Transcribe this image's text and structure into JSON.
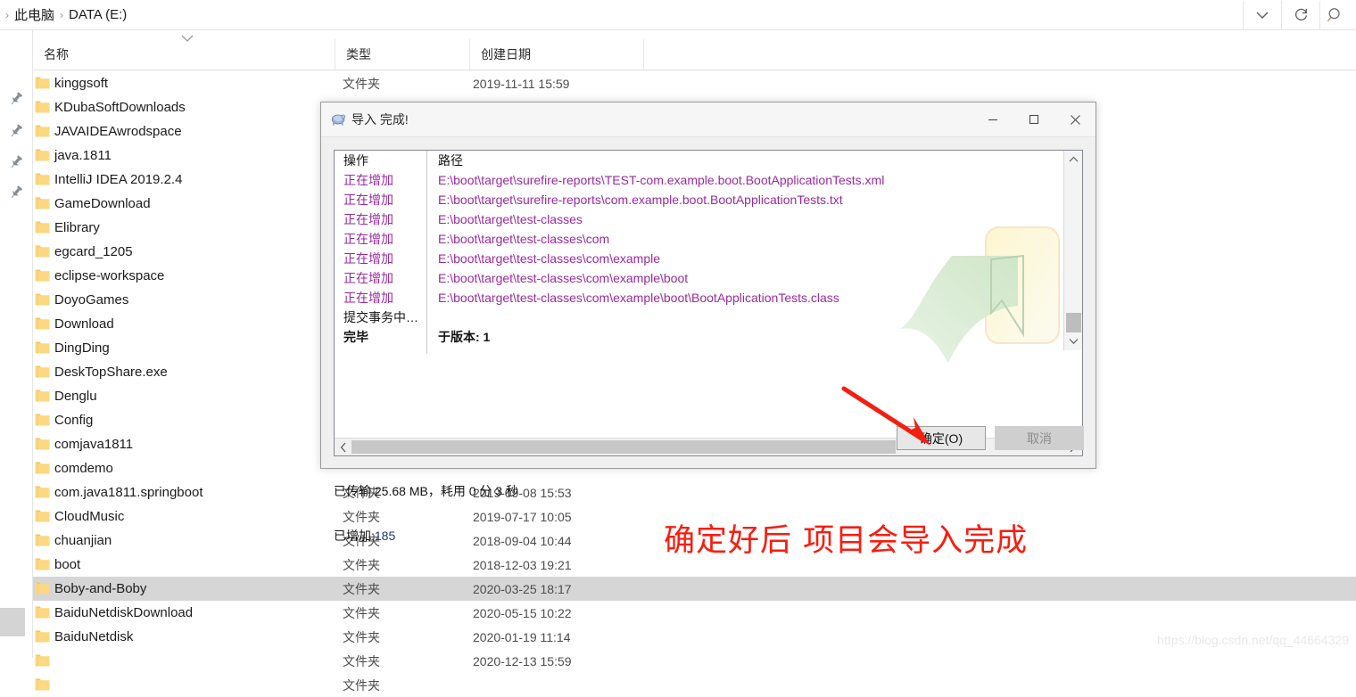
{
  "explorer": {
    "breadcrumb": {
      "leading_separator": "›",
      "items": [
        "此电脑",
        "DATA (E:)"
      ],
      "separator": "›"
    },
    "toolbar": {
      "history_dropdown": "chevron-down-icon",
      "refresh": "refresh-icon",
      "search": "search-icon"
    },
    "columns": [
      {
        "key": "name",
        "label": "名称"
      },
      {
        "key": "type",
        "label": "类型"
      },
      {
        "key": "date",
        "label": "创建日期"
      }
    ],
    "sort_indicator": "chevron-up-icon",
    "rows": [
      {
        "name": "kinggsoft",
        "type": "文件夹",
        "date": "2019-11-11 15:59",
        "selected": false
      },
      {
        "name": "KDubaSoftDownloads",
        "type": "",
        "date": "",
        "selected": false
      },
      {
        "name": "JAVAIDEAwrodspace",
        "type": "",
        "date": "",
        "selected": false
      },
      {
        "name": "java.1811",
        "type": "",
        "date": "",
        "selected": false
      },
      {
        "name": "IntelliJ IDEA 2019.2.4",
        "type": "",
        "date": "",
        "selected": false
      },
      {
        "name": "GameDownload",
        "type": "",
        "date": "",
        "selected": false
      },
      {
        "name": "Elibrary",
        "type": "",
        "date": "",
        "selected": false
      },
      {
        "name": "egcard_1205",
        "type": "",
        "date": "",
        "selected": false
      },
      {
        "name": "eclipse-workspace",
        "type": "",
        "date": "",
        "selected": false
      },
      {
        "name": "DoyoGames",
        "type": "",
        "date": "",
        "selected": false
      },
      {
        "name": "Download",
        "type": "",
        "date": "",
        "selected": false
      },
      {
        "name": "DingDing",
        "type": "",
        "date": "",
        "selected": false
      },
      {
        "name": "DeskTopShare.exe",
        "type": "",
        "date": "",
        "selected": false
      },
      {
        "name": "Denglu",
        "type": "",
        "date": "",
        "selected": false
      },
      {
        "name": "Config",
        "type": "",
        "date": "",
        "selected": false
      },
      {
        "name": "comjava1811",
        "type": "",
        "date": "",
        "selected": false
      },
      {
        "name": "comdemo",
        "type": "",
        "date": "",
        "selected": false
      },
      {
        "name": "com.java1811.springboot",
        "type": "文件夹",
        "date": "2019-09-08 15:53",
        "selected": false
      },
      {
        "name": "CloudMusic",
        "type": "文件夹",
        "date": "2019-07-17 10:05",
        "selected": false
      },
      {
        "name": "chuanjian",
        "type": "文件夹",
        "date": "2018-09-04 10:44",
        "selected": false
      },
      {
        "name": "boot",
        "type": "文件夹",
        "date": "2018-12-03 19:21",
        "selected": false
      },
      {
        "name": "Boby-and-Boby",
        "type": "文件夹",
        "date": "2020-03-25 18:17",
        "selected": true
      },
      {
        "name": "BaiduNetdiskDownload",
        "type": "文件夹",
        "date": "2020-05-15 10:22",
        "selected": false
      },
      {
        "name": "BaiduNetdisk",
        "type": "文件夹",
        "date": "2020-01-19 11:14",
        "selected": false
      },
      {
        "name": "",
        "type": "文件夹",
        "date": "2020-12-13 15:59",
        "selected": false
      },
      {
        "name": "",
        "type": "文件夹",
        "date": "",
        "selected": false
      }
    ]
  },
  "dialog": {
    "title": "导入 完成!",
    "icon": "tortoise-svn-icon",
    "titlebar": {
      "minimize": "minimize-icon",
      "maximize": "maximize-icon",
      "close": "close-icon"
    },
    "log": {
      "headers": {
        "action": "操作",
        "path": "路径"
      },
      "entries": [
        {
          "action": "正在增加",
          "path": "E:\\boot\\target\\surefire-reports\\TEST-com.example.boot.BootApplicationTests.xml",
          "style": "add"
        },
        {
          "action": "正在增加",
          "path": "E:\\boot\\target\\surefire-reports\\com.example.boot.BootApplicationTests.txt",
          "style": "add"
        },
        {
          "action": "正在增加",
          "path": "E:\\boot\\target\\test-classes",
          "style": "add"
        },
        {
          "action": "正在增加",
          "path": "E:\\boot\\target\\test-classes\\com",
          "style": "add"
        },
        {
          "action": "正在增加",
          "path": "E:\\boot\\target\\test-classes\\com\\example",
          "style": "add"
        },
        {
          "action": "正在增加",
          "path": "E:\\boot\\target\\test-classes\\com\\example\\boot",
          "style": "add"
        },
        {
          "action": "正在增加",
          "path": "E:\\boot\\target\\test-classes\\com\\example\\boot\\BootApplicationTests.class",
          "style": "add"
        },
        {
          "action": "提交事务中…",
          "path": "",
          "style": "dark"
        },
        {
          "action": "完毕",
          "path": "于版本: 1",
          "style": "bold"
        }
      ]
    },
    "scrollbars": {
      "vertical_up": "chevron-up-icon",
      "vertical_down": "chevron-down-icon",
      "horizontal_left": "chevron-left-icon",
      "horizontal_right": "chevron-right-icon"
    },
    "status_transfer": "已传输 25.68 MB，耗用 0 分 3 秒",
    "status_added_label": "已增加:",
    "status_added_value": "185",
    "buttons": {
      "ok": "确定(O)",
      "cancel": "取消"
    }
  },
  "annotations": {
    "note": "确定好后 项目会导入完成",
    "note_color": "#fa1c0f",
    "arrow": "red-arrow"
  },
  "watermark": "https://blog.csdn.net/qq_44664329"
}
